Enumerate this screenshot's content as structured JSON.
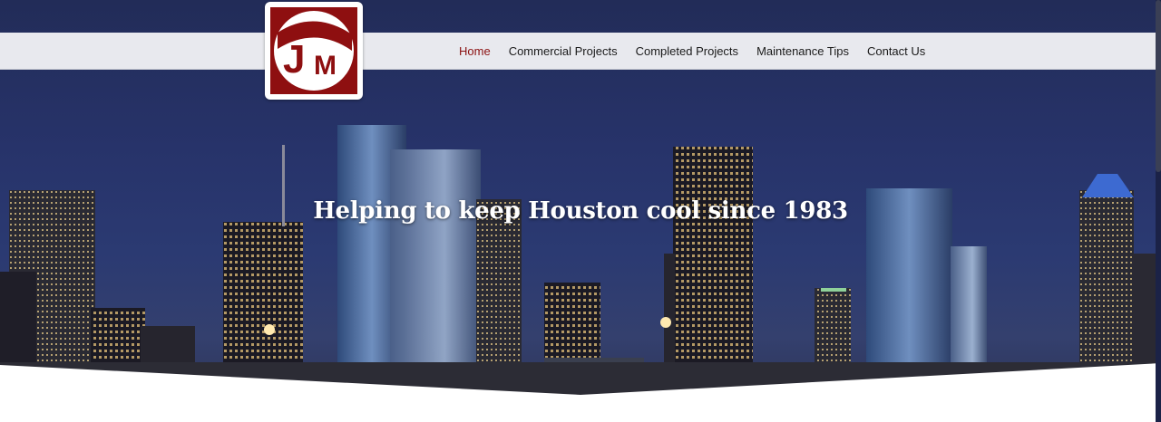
{
  "logo": {
    "letter_1": "J",
    "letter_2": "M"
  },
  "nav": {
    "items": [
      {
        "label": "Home"
      },
      {
        "label": "Commercial Projects"
      },
      {
        "label": "Completed Projects"
      },
      {
        "label": "Maintenance Tips"
      },
      {
        "label": "Contact Us"
      }
    ],
    "active_index": 0
  },
  "hero": {
    "headline": "Helping to keep Houston cool since 1983"
  },
  "colors": {
    "brand_red": "#8e0f10",
    "nav_bg": "#e8e9ee",
    "nav_active": "#8b1010",
    "sky": "#27336a"
  },
  "icons": [
    "logo-mark"
  ]
}
